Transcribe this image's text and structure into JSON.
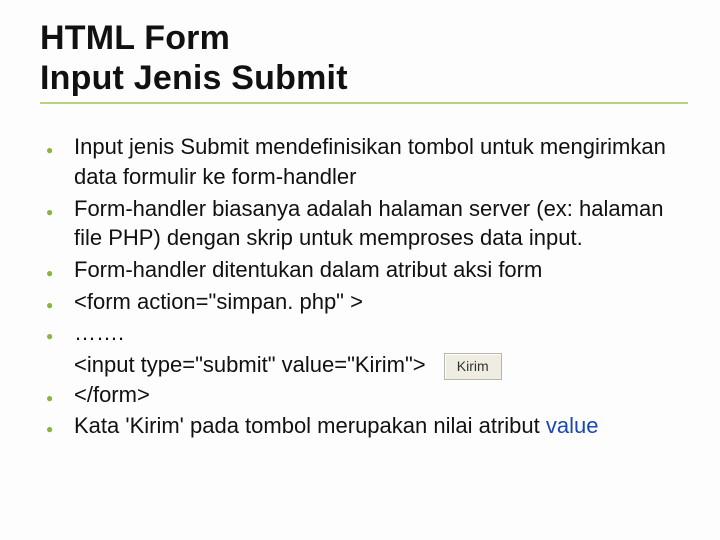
{
  "title": {
    "line1": "HTML Form",
    "line2": "Input Jenis Submit"
  },
  "bullets": {
    "b1": "Input jenis Submit mendefinisikan tombol untuk mengirimkan data formulir ke form-handler",
    "b2": "Form-handler biasanya adalah halaman server (ex: halaman file PHP) dengan skrip untuk memproses data input.",
    "b3": "Form-handler ditentukan dalam atribut aksi form",
    "b4": "<form action=\"simpan. php\" >",
    "b5": " …….",
    "b5_cont": "<input type=\"submit\" value=\"Kirim\">",
    "demo_button": "Kirim",
    "b6": "</form>",
    "b7_pre": "Kata 'Kirim' pada tombol merupakan nilai atribut ",
    "b7_blue": "value"
  }
}
